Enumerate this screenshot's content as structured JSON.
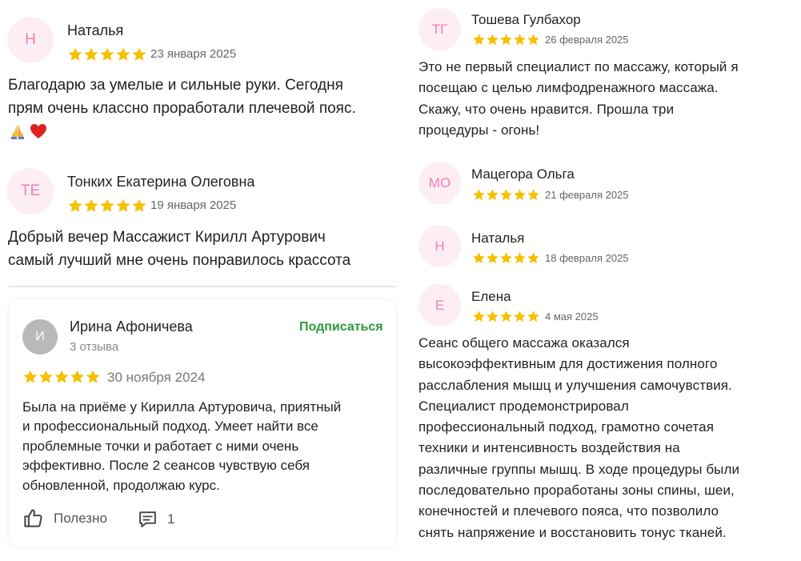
{
  "left": {
    "reviews": [
      {
        "initials": "Н",
        "name": "Наталья",
        "date": "23 января 2025",
        "stars": 5,
        "text_lines": [
          "Благодарю за умелые и сильные руки. Сегодня",
          "прям очень классно проработали плечевой пояс."
        ],
        "emoji": "🙏❤️"
      },
      {
        "initials": "ТЕ",
        "name": "Тонких Екатерина Олеговна",
        "date": "19 января 2025",
        "stars": 5,
        "text_lines": [
          "Добрый вечер Массажист Кирилл Артурович",
          "самый лучший мне очень понравилось крассота"
        ]
      }
    ],
    "card": {
      "initials": "И",
      "name": "Ирина Афоничева",
      "review_count": "3 отзыва",
      "subscribe_label": "Подписаться",
      "date": "30 ноября 2024",
      "stars": 5,
      "text_lines": [
        "Была на приёме у Кирилла Артуровича, приятный",
        "и профессиональный подход. Умеет найти все",
        "проблемные точки и работает с ними очень",
        "эффективно. После 2 сеансов чувствую себя",
        "обновленной, продолжаю курс."
      ],
      "helpful_label": "Полезно",
      "comments_count": "1"
    }
  },
  "right": {
    "reviews": [
      {
        "initials": "ТГ",
        "name": "Тошева Гулбахор",
        "date": "26 февраля 2025",
        "stars": 5,
        "text_lines": [
          "Это не первый специалист по массажу, который я",
          "посещаю с целью лимфодренажного массажа.",
          "Скажу, что очень нравится. Прошла три",
          "процедуры - огонь!"
        ]
      },
      {
        "initials": "МО",
        "name": "Мацегора Ольга",
        "date": "21 февраля 2025",
        "stars": 5
      },
      {
        "initials": "Н",
        "name": "Наталья",
        "date": "18 февраля 2025",
        "stars": 5
      },
      {
        "initials": "Е",
        "name": "Елена",
        "date": "4 мая 2025",
        "stars": 5,
        "text_lines": [
          "Сеанс общего массажа оказался",
          "высокоэффективным для достижения полного",
          "расслабления мышц и улучшения самочувствия.",
          "Специалист продемонстрировал",
          "профессиональный подход, грамотно сочетая",
          "техники и интенсивность воздействия на",
          "различные группы мышц. В ходе процедуры были",
          "последовательно проработаны зоны спины, шеи,",
          "конечностей и плечевого пояса, что позволило",
          "снять напряжение и восстановить тонус тканей."
        ]
      }
    ]
  },
  "colors": {
    "star": "#f5c000",
    "avatar_bg": "#fdeef4",
    "avatar_text": "#f07fb0",
    "subscribe": "#2b9a3c",
    "grey_avatar": "#b9b9b9"
  },
  "icons": [
    "star-icon",
    "thumbs-up-icon",
    "comment-icon"
  ]
}
